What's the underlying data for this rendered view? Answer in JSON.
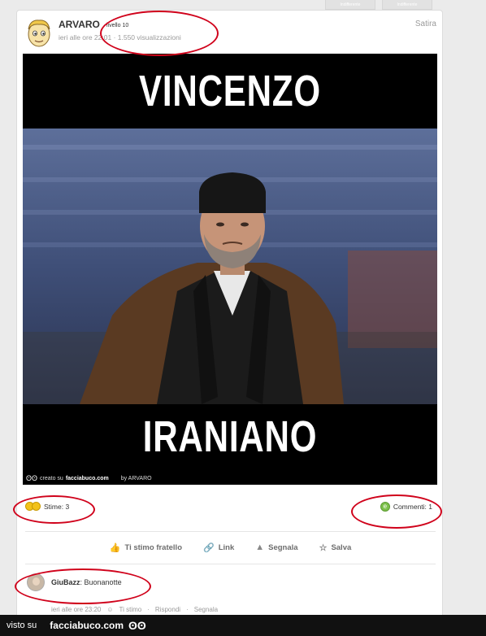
{
  "top_tabs": [
    "Indifferente",
    "Indifferente"
  ],
  "post": {
    "author": "ARVARO",
    "level": "livello 10",
    "meta": "ieri alle ore 22:01 · 1.550 visualizzazioni",
    "category": "Satira"
  },
  "meme": {
    "top_text": "VINCENZO",
    "bottom_text": "IRANIANO",
    "footer_created": "creato su",
    "footer_brand": "facciabuco.com",
    "footer_by": "by ARVARO"
  },
  "stats": {
    "stime": "Stime: 3",
    "comments": "Commenti: 1"
  },
  "actions": [
    {
      "label": "Ti stimo fratello",
      "icon": "thumb-icon"
    },
    {
      "label": "Link",
      "icon": "link-icon"
    },
    {
      "label": "Segnala",
      "icon": "warning-icon"
    },
    {
      "label": "Salva",
      "icon": "star-icon"
    }
  ],
  "comment": {
    "user": "GiuBazz",
    "text": "Buonanotte",
    "time": "ieri alle ore 23:20",
    "stimo": "Ti stimo",
    "reply": "Rispondi",
    "report": "Segnala"
  },
  "bottombar": {
    "prefix": "visto su",
    "site": "facciabuco.com"
  },
  "colors": {
    "highlight": "#d0021b",
    "meme_bg": "#000000"
  }
}
